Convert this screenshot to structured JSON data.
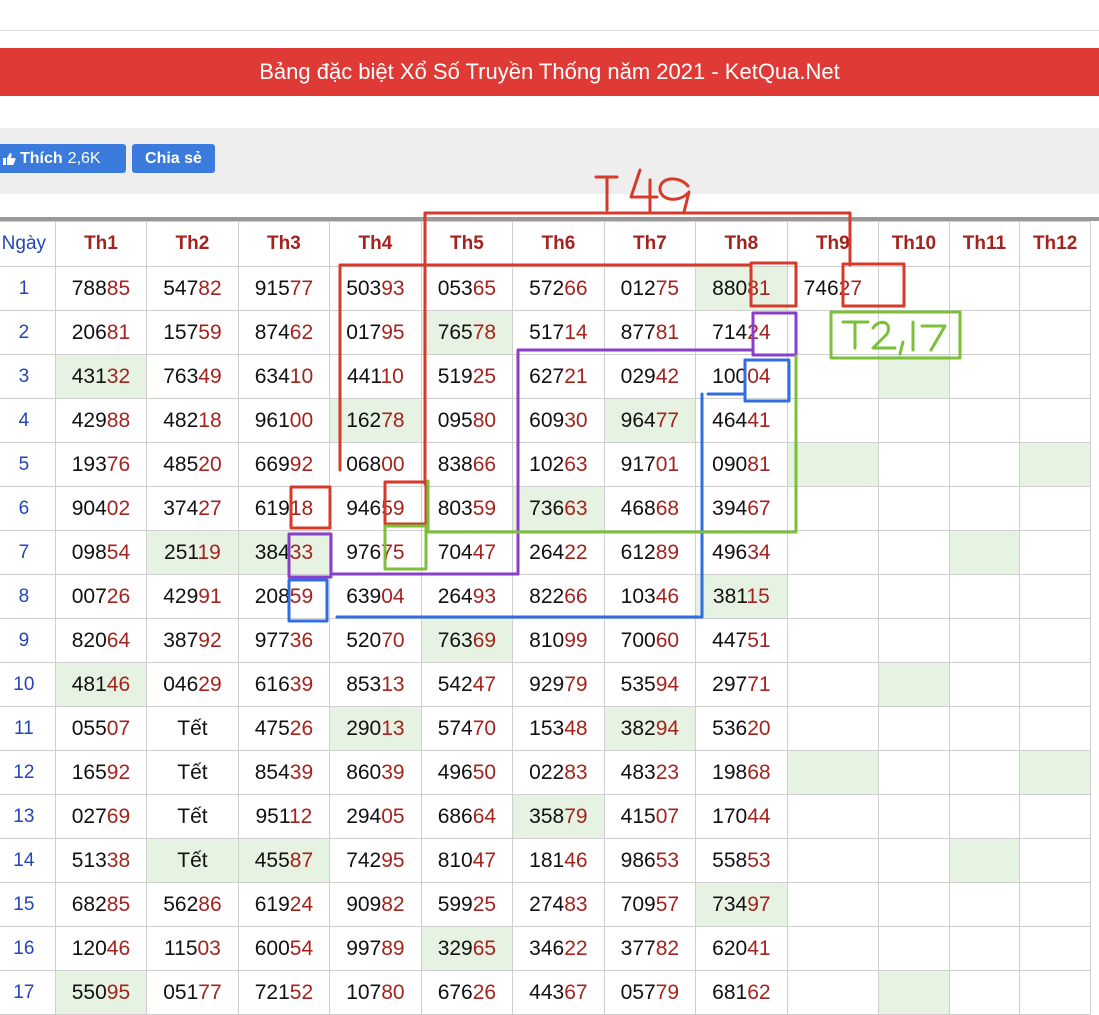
{
  "banner": {
    "title": "Bảng đặc biệt Xổ Số Truyền Thống năm 2021 - KetQua.Net"
  },
  "social": {
    "like_label": "Thích",
    "like_count": "2,6K",
    "share_label": "Chia sẻ"
  },
  "table": {
    "headers": [
      "Ngày",
      "Th1",
      "Th2",
      "Th3",
      "Th4",
      "Th5",
      "Th6",
      "Th7",
      "Th8",
      "Th9",
      "Th10",
      "Th11",
      "Th12"
    ],
    "rows": [
      {
        "day": "1",
        "cells": [
          "78885",
          "54782",
          "91577",
          "50393",
          "05365",
          "57266",
          "01275",
          "88081",
          "74627",
          "",
          "",
          ""
        ],
        "hl": [
          7
        ]
      },
      {
        "day": "2",
        "cells": [
          "20681",
          "15759",
          "87462",
          "01795",
          "76578",
          "51714",
          "87781",
          "71424",
          "",
          "",
          "",
          ""
        ],
        "hl": [
          4
        ]
      },
      {
        "day": "3",
        "cells": [
          "43132",
          "76349",
          "63410",
          "44110",
          "51925",
          "62721",
          "02942",
          "10004",
          "",
          "",
          "",
          ""
        ],
        "hl": [
          0,
          9
        ]
      },
      {
        "day": "4",
        "cells": [
          "42988",
          "48218",
          "96100",
          "16278",
          "09580",
          "60930",
          "96477",
          "46441",
          "",
          "",
          "",
          ""
        ],
        "hl": [
          3,
          6
        ]
      },
      {
        "day": "5",
        "cells": [
          "19376",
          "48520",
          "66992",
          "06800",
          "83866",
          "10263",
          "91701",
          "09081",
          "",
          "",
          "",
          ""
        ],
        "hl": [
          8,
          11
        ]
      },
      {
        "day": "6",
        "cells": [
          "90402",
          "37427",
          "61918",
          "94659",
          "80359",
          "73663",
          "46868",
          "39467",
          "",
          "",
          "",
          ""
        ],
        "hl": [
          5
        ]
      },
      {
        "day": "7",
        "cells": [
          "09854",
          "25119",
          "38433",
          "97675",
          "70447",
          "26422",
          "61289",
          "49634",
          "",
          "",
          "",
          ""
        ],
        "hl": [
          1,
          2,
          10
        ]
      },
      {
        "day": "8",
        "cells": [
          "00726",
          "42991",
          "20859",
          "63904",
          "26493",
          "82266",
          "10346",
          "38115",
          "",
          "",
          "",
          ""
        ],
        "hl": [
          7
        ]
      },
      {
        "day": "9",
        "cells": [
          "82064",
          "38792",
          "97736",
          "52070",
          "76369",
          "81099",
          "70060",
          "44751",
          "",
          "",
          "",
          ""
        ],
        "hl": [
          4
        ]
      },
      {
        "day": "10",
        "cells": [
          "48146",
          "04629",
          "61639",
          "85313",
          "54247",
          "92979",
          "53594",
          "29771",
          "",
          "",
          "",
          ""
        ],
        "hl": [
          0,
          9
        ]
      },
      {
        "day": "11",
        "cells": [
          "05507",
          "Tết",
          "47526",
          "29013",
          "57470",
          "15348",
          "38294",
          "53620",
          "",
          "",
          "",
          ""
        ],
        "hl": [
          3,
          6
        ]
      },
      {
        "day": "12",
        "cells": [
          "16592",
          "Tết",
          "85439",
          "86039",
          "49650",
          "02283",
          "48323",
          "19868",
          "",
          "",
          "",
          ""
        ],
        "hl": [
          8,
          11
        ]
      },
      {
        "day": "13",
        "cells": [
          "02769",
          "Tết",
          "95112",
          "29405",
          "68664",
          "35879",
          "41507",
          "17044",
          "",
          "",
          "",
          ""
        ],
        "hl": [
          5
        ]
      },
      {
        "day": "14",
        "cells": [
          "51338",
          "Tết",
          "45587",
          "74295",
          "81047",
          "18146",
          "98653",
          "55853",
          "",
          "",
          "",
          ""
        ],
        "hl": [
          1,
          2,
          10
        ]
      },
      {
        "day": "15",
        "cells": [
          "68285",
          "56286",
          "61924",
          "90982",
          "59925",
          "27483",
          "70957",
          "73497",
          "",
          "",
          "",
          ""
        ],
        "hl": [
          7
        ]
      },
      {
        "day": "16",
        "cells": [
          "12046",
          "11503",
          "60054",
          "99789",
          "32965",
          "34622",
          "37782",
          "62041",
          "",
          "",
          "",
          ""
        ],
        "hl": [
          4
        ]
      },
      {
        "day": "17",
        "cells": [
          "55095",
          "05177",
          "72152",
          "10780",
          "67626",
          "44367",
          "05779",
          "68162",
          "",
          "",
          "",
          ""
        ],
        "hl": [
          0,
          9
        ]
      }
    ]
  },
  "annotations": {
    "top_label": "T49",
    "side_label": "T2,17"
  },
  "colors": {
    "banner": "#e03a36",
    "button": "#3b7bdd",
    "header_text": "#a3231e",
    "day_text": "#2346b5",
    "highlight": "#e6f2e2",
    "ink_red": "#d63a2a",
    "ink_purple": "#8a3fc8",
    "ink_blue": "#2f6de0",
    "ink_green": "#7bbf3a"
  }
}
